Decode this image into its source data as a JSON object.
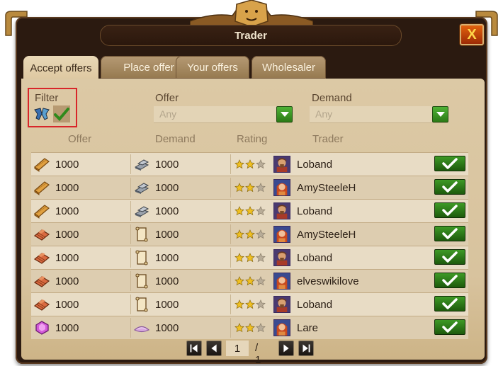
{
  "window": {
    "title": "Trader",
    "close_label": "X"
  },
  "tabs": [
    {
      "label": "Accept offers",
      "active": true
    },
    {
      "label": "Place offer",
      "active": false
    },
    {
      "label": "Your offers",
      "active": false
    },
    {
      "label": "Wholesaler",
      "active": false
    }
  ],
  "filter": {
    "label": "Filter",
    "icons": [
      "sandals-icon",
      "checkmark-icon"
    ]
  },
  "offer_select": {
    "label": "Offer",
    "value": "Any"
  },
  "demand_select": {
    "label": "Demand",
    "value": "Any"
  },
  "columns": [
    "Offer",
    "Demand",
    "Rating",
    "Trader"
  ],
  "rows": [
    {
      "offer_icon": "planks-icon",
      "offer_qty": "1000",
      "demand_icon": "steel-icon",
      "demand_qty": "1000",
      "rating": 2,
      "max_rating": 3,
      "trader": "Loband",
      "avatar": "male-avatar-icon"
    },
    {
      "offer_icon": "planks-icon",
      "offer_qty": "1000",
      "demand_icon": "steel-icon",
      "demand_qty": "1000",
      "rating": 2,
      "max_rating": 3,
      "trader": "AmySteeleH",
      "avatar": "female-avatar-icon"
    },
    {
      "offer_icon": "planks-icon",
      "offer_qty": "1000",
      "demand_icon": "steel-icon",
      "demand_qty": "1000",
      "rating": 2,
      "max_rating": 3,
      "trader": "Loband",
      "avatar": "male-avatar-icon"
    },
    {
      "offer_icon": "bricks-icon",
      "offer_qty": "1000",
      "demand_icon": "scroll-icon",
      "demand_qty": "1000",
      "rating": 2,
      "max_rating": 3,
      "trader": "AmySteeleH",
      "avatar": "female-avatar-icon"
    },
    {
      "offer_icon": "bricks-icon",
      "offer_qty": "1000",
      "demand_icon": "scroll-icon",
      "demand_qty": "1000",
      "rating": 2,
      "max_rating": 3,
      "trader": "Loband",
      "avatar": "male-avatar-icon"
    },
    {
      "offer_icon": "bricks-icon",
      "offer_qty": "1000",
      "demand_icon": "scroll-icon",
      "demand_qty": "1000",
      "rating": 2,
      "max_rating": 3,
      "trader": "elveswikilove",
      "avatar": "female-avatar-icon"
    },
    {
      "offer_icon": "bricks-icon",
      "offer_qty": "1000",
      "demand_icon": "scroll-icon",
      "demand_qty": "1000",
      "rating": 2,
      "max_rating": 3,
      "trader": "Loband",
      "avatar": "male-avatar-icon"
    },
    {
      "offer_icon": "gem-icon",
      "offer_qty": "1000",
      "demand_icon": "silk-icon",
      "demand_qty": "1000",
      "rating": 2,
      "max_rating": 3,
      "trader": "Lare",
      "avatar": "female-avatar-icon"
    }
  ],
  "pagination": {
    "current_page": "1",
    "total_label": "/ 1"
  },
  "colors": {
    "accent_green": "#2f8a1c",
    "close_orange": "#d2540c",
    "panel": "#dcc9a5",
    "frame": "#2b1a10"
  }
}
